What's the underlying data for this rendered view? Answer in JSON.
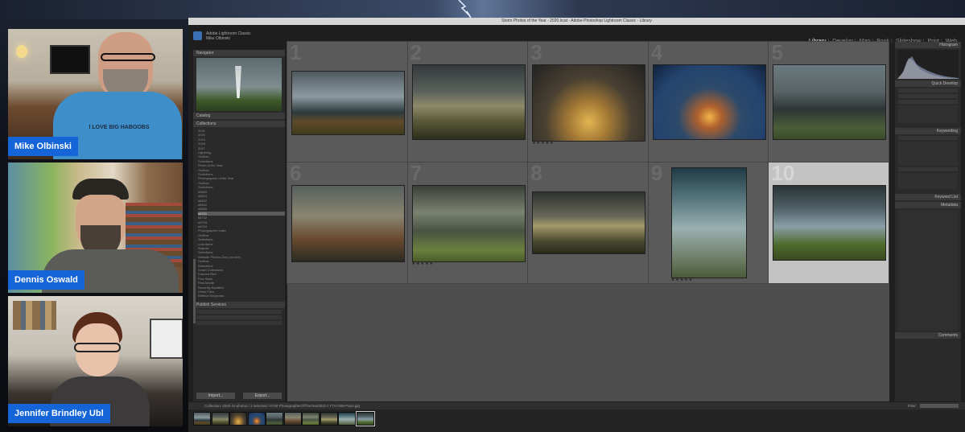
{
  "window": {
    "title": "Storm Photos of the Year - 2020.lrcat - Adobe Photoshop Lightroom Classic - Library",
    "user_line1": "Adobe Lightroom Classic",
    "user_line2": "Mike Olbinski"
  },
  "modules": [
    "Library",
    "Develop",
    "Map",
    "Book",
    "Slideshow",
    "Print",
    "Web"
  ],
  "participants": [
    {
      "name": "Mike Olbinski",
      "shirt_text": "I LOVE BIG HABOOBS"
    },
    {
      "name": "Dennis Oswald"
    },
    {
      "name": "Jennifer Brindley Ubl"
    }
  ],
  "left_panel": {
    "navigator": "Navigator",
    "catalog": "Catalog",
    "collections": "Collections",
    "publish": "Publish Services",
    "tree": [
      "2021",
      "2020",
      "2019",
      "2018",
      "2017",
      "Lightning",
      "Outflow",
      "Selections",
      "Photo of the Year",
      "Outflow",
      "Selections",
      "Photographer of the Year",
      "Outflow",
      "Selections",
      "#6659",
      "#6624",
      "#6622",
      "#6616",
      "#6655",
      "#6701",
      "#6702",
      "#6703",
      "#6704",
      "Photographer Index",
      "Outflow",
      "Selections",
      "Lost Items",
      "Rejects",
      "Selections",
      "Website Photos Only (no line)",
      "Outflow",
      "Selections",
      "Smart Collections",
      "Colored Red",
      "Five Stars",
      "Past Month",
      "Recently Modified",
      "Video Files",
      "Without Keywords"
    ],
    "tree_selected": "#6701",
    "import": "Import...",
    "export": "Export..."
  },
  "grid": {
    "cells": [
      {
        "num": "1",
        "stars": ""
      },
      {
        "num": "2",
        "stars": ""
      },
      {
        "num": "3",
        "stars": "★★★★★"
      },
      {
        "num": "4",
        "stars": ""
      },
      {
        "num": "5",
        "stars": ""
      },
      {
        "num": "6",
        "stars": ""
      },
      {
        "num": "7",
        "stars": "★★★★★"
      },
      {
        "num": "8",
        "stars": ""
      },
      {
        "num": "9",
        "stars": "★★★★★"
      },
      {
        "num": "10",
        "stars": ""
      }
    ]
  },
  "right_panel": {
    "histogram": "Histogram",
    "quick_develop": "Quick Develop",
    "keywording": "Keywording",
    "keyword_list": "Keyword List",
    "metadata": "Metadata",
    "comments": "Comments"
  },
  "bottom": {
    "status": "Collection: 2020    10 photos / 1 selected / 0728 PhotographerOfTheYear2020 / Y7A7486-Pano.jpg",
    "filter": "Filter:"
  }
}
